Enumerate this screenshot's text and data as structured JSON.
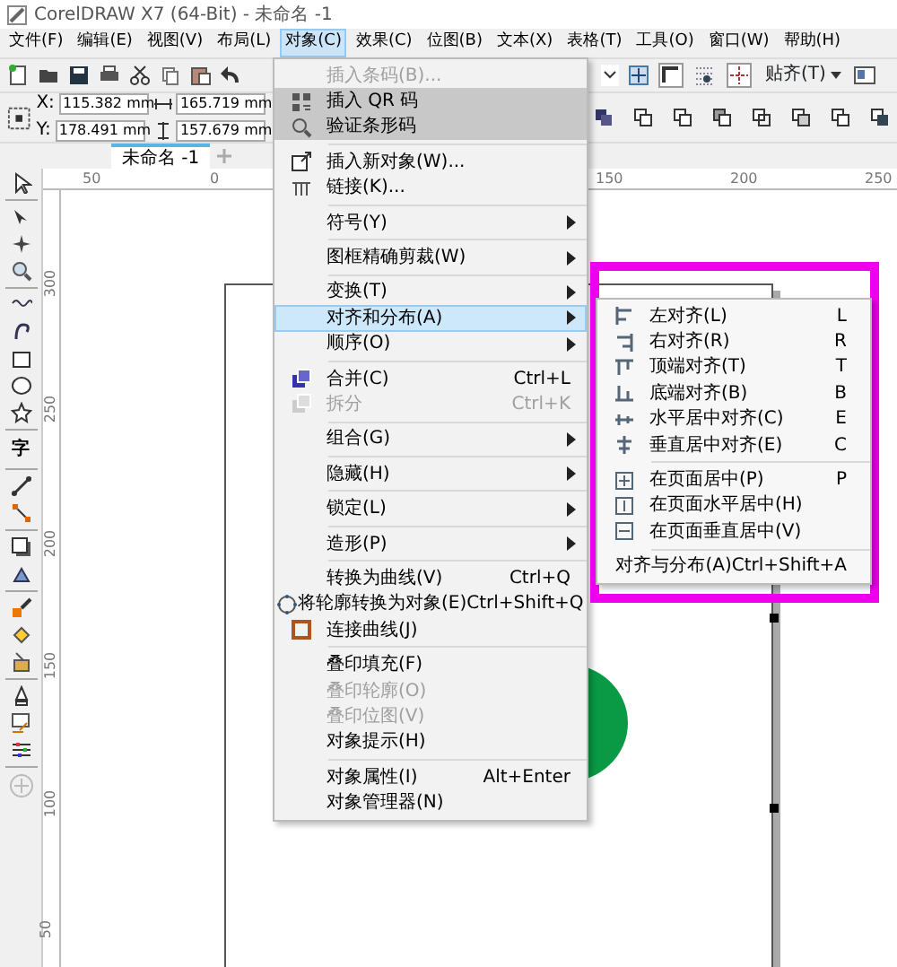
{
  "window": {
    "title": "CorelDRAW X7 (64-Bit) - 未命名 -1"
  },
  "menu_bar": [
    {
      "label": "文件(F)",
      "selected": false
    },
    {
      "label": "编辑(E)",
      "selected": false
    },
    {
      "label": "视图(V)",
      "selected": false
    },
    {
      "label": "布局(L)",
      "selected": false
    },
    {
      "label": "对象(C)",
      "selected": true
    },
    {
      "label": "效果(C)",
      "selected": false
    },
    {
      "label": "位图(B)",
      "selected": false
    },
    {
      "label": "文本(X)",
      "selected": false
    },
    {
      "label": "表格(T)",
      "selected": false
    },
    {
      "label": "工具(O)",
      "selected": false
    },
    {
      "label": "窗口(W)",
      "selected": false
    },
    {
      "label": "帮助(H)",
      "selected": false
    }
  ],
  "toolbar": {
    "snap_button": "贴齐(T)"
  },
  "property_bar": {
    "x_label": "X:",
    "x_value": "115.382 mm",
    "y_label": "Y:",
    "y_value": "178.491 mm",
    "width_value": "165.719 mm",
    "height_value": "157.679 mm"
  },
  "document_tabs": [
    {
      "label": "未命名 -1",
      "selected": true
    }
  ],
  "horizontal_ruler": [
    "50",
    "0",
    "150",
    "200",
    "250"
  ],
  "vertical_ruler": [
    "300",
    "250",
    "200",
    "150",
    "100",
    "50"
  ],
  "toolbox": {
    "text_tool_glyph": "字"
  },
  "object_menu": [
    {
      "kind": "item",
      "label": "插入条码(B)...",
      "disabled": true,
      "selected": false,
      "shaded": false,
      "submenu": false
    },
    {
      "kind": "item",
      "label": "插入 QR 码",
      "disabled": false,
      "selected": false,
      "shaded": true,
      "submenu": false
    },
    {
      "kind": "item",
      "label": "验证条形码",
      "disabled": false,
      "selected": false,
      "shaded": true,
      "submenu": false
    },
    {
      "kind": "separator"
    },
    {
      "kind": "item",
      "label": "插入新对象(W)...",
      "disabled": false,
      "selected": false,
      "shaded": false,
      "submenu": false
    },
    {
      "kind": "item",
      "label": "链接(K)...",
      "disabled": false,
      "selected": false,
      "shaded": false,
      "submenu": false
    },
    {
      "kind": "separator"
    },
    {
      "kind": "item",
      "label": "符号(Y)",
      "disabled": false,
      "selected": false,
      "shaded": false,
      "submenu": true
    },
    {
      "kind": "separator"
    },
    {
      "kind": "item",
      "label": "图框精确剪裁(W)",
      "disabled": false,
      "selected": false,
      "shaded": false,
      "submenu": true
    },
    {
      "kind": "separator"
    },
    {
      "kind": "item",
      "label": "变换(T)",
      "disabled": false,
      "selected": false,
      "shaded": false,
      "submenu": true
    },
    {
      "kind": "item",
      "label": "对齐和分布(A)",
      "disabled": false,
      "selected": true,
      "shaded": false,
      "submenu": true
    },
    {
      "kind": "item",
      "label": "顺序(O)",
      "disabled": false,
      "selected": false,
      "shaded": false,
      "submenu": true
    },
    {
      "kind": "separator"
    },
    {
      "kind": "item",
      "label": "合并(C)",
      "shortcut": "Ctrl+L",
      "disabled": false,
      "selected": false,
      "shaded": false,
      "submenu": false
    },
    {
      "kind": "item",
      "label": "拆分",
      "shortcut": "Ctrl+K",
      "disabled": true,
      "selected": false,
      "shaded": false,
      "submenu": false
    },
    {
      "kind": "separator"
    },
    {
      "kind": "item",
      "label": "组合(G)",
      "disabled": false,
      "selected": false,
      "shaded": false,
      "submenu": true
    },
    {
      "kind": "separator"
    },
    {
      "kind": "item",
      "label": "隐藏(H)",
      "disabled": false,
      "selected": false,
      "shaded": false,
      "submenu": true
    },
    {
      "kind": "separator"
    },
    {
      "kind": "item",
      "label": "锁定(L)",
      "disabled": false,
      "selected": false,
      "shaded": false,
      "submenu": true
    },
    {
      "kind": "separator"
    },
    {
      "kind": "item",
      "label": "造形(P)",
      "disabled": false,
      "selected": false,
      "shaded": false,
      "submenu": true
    },
    {
      "kind": "separator"
    },
    {
      "kind": "item",
      "label": "转换为曲线(V)",
      "shortcut": "Ctrl+Q",
      "disabled": false,
      "selected": false,
      "shaded": false,
      "submenu": false
    },
    {
      "kind": "item",
      "label": "将轮廓转换为对象(E)",
      "shortcut": "Ctrl+Shift+Q",
      "disabled": false,
      "selected": false,
      "shaded": false,
      "submenu": false
    },
    {
      "kind": "item",
      "label": "连接曲线(J)",
      "disabled": false,
      "selected": false,
      "shaded": false,
      "submenu": false
    },
    {
      "kind": "separator"
    },
    {
      "kind": "item",
      "label": "叠印填充(F)",
      "disabled": false,
      "selected": false,
      "shaded": false,
      "submenu": false
    },
    {
      "kind": "item",
      "label": "叠印轮廓(O)",
      "disabled": true,
      "selected": false,
      "shaded": false,
      "submenu": false
    },
    {
      "kind": "item",
      "label": "叠印位图(V)",
      "disabled": true,
      "selected": false,
      "shaded": false,
      "submenu": false
    },
    {
      "kind": "item",
      "label": "对象提示(H)",
      "disabled": false,
      "selected": false,
      "shaded": false,
      "submenu": false
    },
    {
      "kind": "separator"
    },
    {
      "kind": "item",
      "label": "对象属性(I)",
      "shortcut": "Alt+Enter",
      "disabled": false,
      "selected": false,
      "shaded": false,
      "submenu": false
    },
    {
      "kind": "item",
      "label": "对象管理器(N)",
      "disabled": false,
      "selected": false,
      "shaded": false,
      "submenu": false
    }
  ],
  "align_submenu": [
    {
      "kind": "item",
      "label": "左对齐(L)",
      "shortcut": "L"
    },
    {
      "kind": "item",
      "label": "右对齐(R)",
      "shortcut": "R"
    },
    {
      "kind": "item",
      "label": "顶端对齐(T)",
      "shortcut": "T"
    },
    {
      "kind": "item",
      "label": "底端对齐(B)",
      "shortcut": "B"
    },
    {
      "kind": "item",
      "label": "水平居中对齐(C)",
      "shortcut": "E"
    },
    {
      "kind": "item",
      "label": "垂直居中对齐(E)",
      "shortcut": "C"
    },
    {
      "kind": "separator"
    },
    {
      "kind": "item",
      "label": "在页面居中(P)",
      "shortcut": "P"
    },
    {
      "kind": "item",
      "label": "在页面水平居中(H)"
    },
    {
      "kind": "item",
      "label": "在页面垂直居中(V)"
    },
    {
      "kind": "separator"
    },
    {
      "kind": "item",
      "label": "对齐与分布(A)",
      "shortcut": "Ctrl+Shift+A"
    }
  ]
}
